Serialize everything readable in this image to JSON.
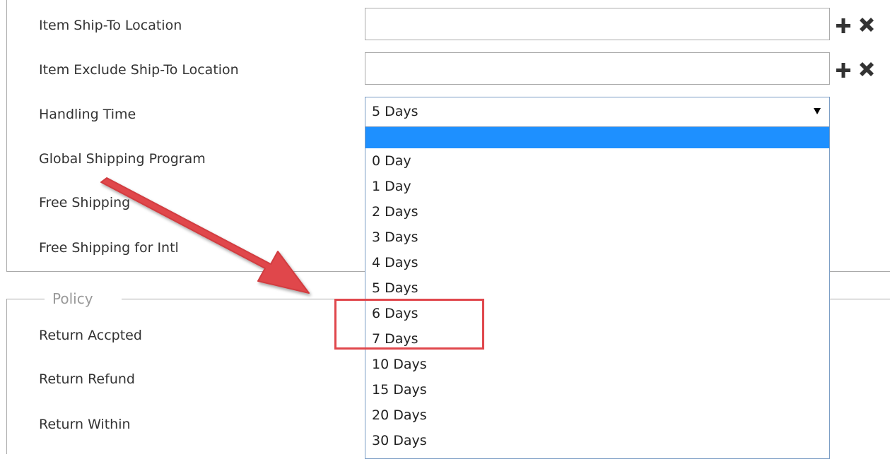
{
  "fields": {
    "item_ship_to": "Item Ship-To Location",
    "item_exclude_ship_to": "Item Exclude Ship-To Location",
    "handling_time": "Handling Time",
    "global_shipping": "Global Shipping Program",
    "free_shipping": "Free Shipping",
    "free_shipping_intl": "Free Shipping for Intl"
  },
  "handling_time_select": {
    "selected_value": "5 Days",
    "options": [
      "",
      "0 Day",
      "1 Day",
      "2 Days",
      "3 Days",
      "4 Days",
      "5 Days",
      "6 Days",
      "7 Days",
      "10 Days",
      "15 Days",
      "20 Days",
      "30 Days"
    ]
  },
  "policy": {
    "legend": "Policy",
    "return_accepted": "Return Accpted",
    "return_refund": "Return Refund",
    "return_within": "Return Within"
  },
  "annotation": {
    "arrow_color": "#e0474c",
    "box_color": "#e0474c"
  },
  "colors": {
    "option_highlight": "#1e90ff"
  }
}
